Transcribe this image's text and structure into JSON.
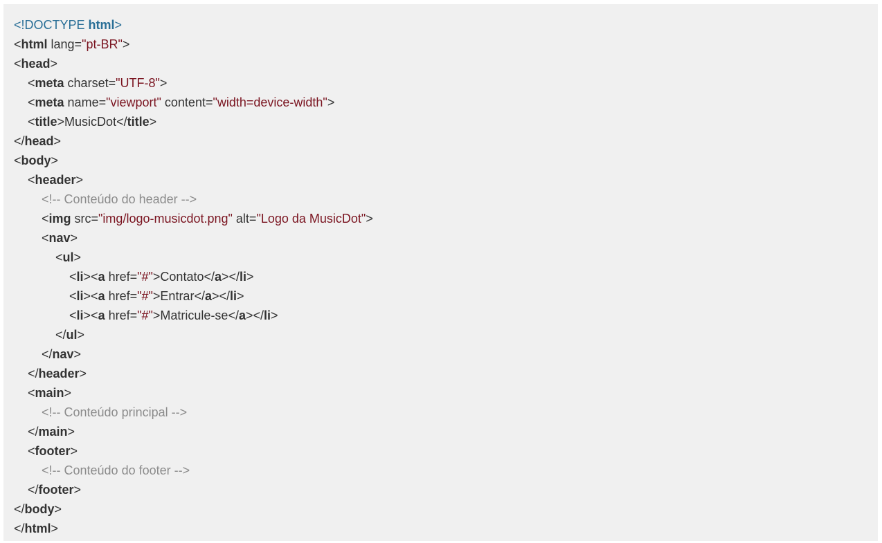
{
  "code": {
    "indent_unit": 20,
    "lines": [
      {
        "indent": 0,
        "tokens": [
          {
            "t": "doctype",
            "v": "<!DOCTYPE "
          },
          {
            "t": "doctype-kw",
            "v": "html"
          },
          {
            "t": "doctype",
            "v": ">"
          }
        ]
      },
      {
        "indent": 0,
        "tokens": [
          {
            "t": "punct",
            "v": "<"
          },
          {
            "t": "tag",
            "v": "html"
          },
          {
            "t": "attr",
            "v": " lang="
          },
          {
            "t": "val",
            "v": "\"pt-BR\""
          },
          {
            "t": "punct",
            "v": ">"
          }
        ]
      },
      {
        "indent": 0,
        "tokens": [
          {
            "t": "punct",
            "v": "<"
          },
          {
            "t": "tag",
            "v": "head"
          },
          {
            "t": "punct",
            "v": ">"
          }
        ]
      },
      {
        "indent": 1,
        "tokens": [
          {
            "t": "punct",
            "v": "<"
          },
          {
            "t": "tag",
            "v": "meta"
          },
          {
            "t": "attr",
            "v": " charset="
          },
          {
            "t": "val",
            "v": "\"UTF-8\""
          },
          {
            "t": "punct",
            "v": ">"
          }
        ]
      },
      {
        "indent": 1,
        "tokens": [
          {
            "t": "punct",
            "v": "<"
          },
          {
            "t": "tag",
            "v": "meta"
          },
          {
            "t": "attr",
            "v": " name="
          },
          {
            "t": "val",
            "v": "\"viewport\""
          },
          {
            "t": "attr",
            "v": " content="
          },
          {
            "t": "val",
            "v": "\"width=device-width\""
          },
          {
            "t": "punct",
            "v": ">"
          }
        ]
      },
      {
        "indent": 1,
        "tokens": [
          {
            "t": "punct",
            "v": "<"
          },
          {
            "t": "tag",
            "v": "title"
          },
          {
            "t": "punct",
            "v": ">"
          },
          {
            "t": "text",
            "v": "MusicDot"
          },
          {
            "t": "punct",
            "v": "</"
          },
          {
            "t": "tag",
            "v": "title"
          },
          {
            "t": "punct",
            "v": ">"
          }
        ]
      },
      {
        "indent": 0,
        "tokens": [
          {
            "t": "punct",
            "v": "</"
          },
          {
            "t": "tag",
            "v": "head"
          },
          {
            "t": "punct",
            "v": ">"
          }
        ]
      },
      {
        "indent": 0,
        "tokens": [
          {
            "t": "punct",
            "v": "<"
          },
          {
            "t": "tag",
            "v": "body"
          },
          {
            "t": "punct",
            "v": ">"
          }
        ]
      },
      {
        "indent": 1,
        "tokens": [
          {
            "t": "punct",
            "v": "<"
          },
          {
            "t": "tag",
            "v": "header"
          },
          {
            "t": "punct",
            "v": ">"
          }
        ]
      },
      {
        "indent": 2,
        "tokens": [
          {
            "t": "comment",
            "v": "<!-- Conteúdo do header -->"
          }
        ]
      },
      {
        "indent": 2,
        "tokens": [
          {
            "t": "punct",
            "v": "<"
          },
          {
            "t": "tag",
            "v": "img"
          },
          {
            "t": "attr",
            "v": " src="
          },
          {
            "t": "val",
            "v": "\"img/logo-musicdot.png\""
          },
          {
            "t": "attr",
            "v": " alt="
          },
          {
            "t": "val",
            "v": "\"Logo da MusicDot\""
          },
          {
            "t": "punct",
            "v": ">"
          }
        ]
      },
      {
        "indent": 2,
        "tokens": [
          {
            "t": "punct",
            "v": "<"
          },
          {
            "t": "tag",
            "v": "nav"
          },
          {
            "t": "punct",
            "v": ">"
          }
        ]
      },
      {
        "indent": 3,
        "tokens": [
          {
            "t": "punct",
            "v": "<"
          },
          {
            "t": "tag",
            "v": "ul"
          },
          {
            "t": "punct",
            "v": ">"
          }
        ]
      },
      {
        "indent": 4,
        "tokens": [
          {
            "t": "punct",
            "v": "<"
          },
          {
            "t": "tag",
            "v": "li"
          },
          {
            "t": "punct",
            "v": "><"
          },
          {
            "t": "tag",
            "v": "a"
          },
          {
            "t": "attr",
            "v": " href="
          },
          {
            "t": "val",
            "v": "\"#\""
          },
          {
            "t": "punct",
            "v": ">"
          },
          {
            "t": "text",
            "v": "Contato"
          },
          {
            "t": "punct",
            "v": "</"
          },
          {
            "t": "tag",
            "v": "a"
          },
          {
            "t": "punct",
            "v": "></"
          },
          {
            "t": "tag",
            "v": "li"
          },
          {
            "t": "punct",
            "v": ">"
          }
        ]
      },
      {
        "indent": 4,
        "tokens": [
          {
            "t": "punct",
            "v": "<"
          },
          {
            "t": "tag",
            "v": "li"
          },
          {
            "t": "punct",
            "v": "><"
          },
          {
            "t": "tag",
            "v": "a"
          },
          {
            "t": "attr",
            "v": " href="
          },
          {
            "t": "val",
            "v": "\"#\""
          },
          {
            "t": "punct",
            "v": ">"
          },
          {
            "t": "text",
            "v": "Entrar"
          },
          {
            "t": "punct",
            "v": "</"
          },
          {
            "t": "tag",
            "v": "a"
          },
          {
            "t": "punct",
            "v": "></"
          },
          {
            "t": "tag",
            "v": "li"
          },
          {
            "t": "punct",
            "v": ">"
          }
        ]
      },
      {
        "indent": 4,
        "tokens": [
          {
            "t": "punct",
            "v": "<"
          },
          {
            "t": "tag",
            "v": "li"
          },
          {
            "t": "punct",
            "v": "><"
          },
          {
            "t": "tag",
            "v": "a"
          },
          {
            "t": "attr",
            "v": " href="
          },
          {
            "t": "val",
            "v": "\"#\""
          },
          {
            "t": "punct",
            "v": ">"
          },
          {
            "t": "text",
            "v": "Matricule-se"
          },
          {
            "t": "punct",
            "v": "</"
          },
          {
            "t": "tag",
            "v": "a"
          },
          {
            "t": "punct",
            "v": "></"
          },
          {
            "t": "tag",
            "v": "li"
          },
          {
            "t": "punct",
            "v": ">"
          }
        ]
      },
      {
        "indent": 3,
        "tokens": [
          {
            "t": "punct",
            "v": "</"
          },
          {
            "t": "tag",
            "v": "ul"
          },
          {
            "t": "punct",
            "v": ">"
          }
        ]
      },
      {
        "indent": 2,
        "tokens": [
          {
            "t": "punct",
            "v": "</"
          },
          {
            "t": "tag",
            "v": "nav"
          },
          {
            "t": "punct",
            "v": ">"
          }
        ]
      },
      {
        "indent": 1,
        "tokens": [
          {
            "t": "punct",
            "v": "</"
          },
          {
            "t": "tag",
            "v": "header"
          },
          {
            "t": "punct",
            "v": ">"
          }
        ]
      },
      {
        "indent": 1,
        "tokens": [
          {
            "t": "punct",
            "v": "<"
          },
          {
            "t": "tag",
            "v": "main"
          },
          {
            "t": "punct",
            "v": ">"
          }
        ]
      },
      {
        "indent": 2,
        "tokens": [
          {
            "t": "comment",
            "v": "<!-- Conteúdo principal -->"
          }
        ]
      },
      {
        "indent": 1,
        "tokens": [
          {
            "t": "punct",
            "v": "</"
          },
          {
            "t": "tag",
            "v": "main"
          },
          {
            "t": "punct",
            "v": ">"
          }
        ]
      },
      {
        "indent": 1,
        "tokens": [
          {
            "t": "punct",
            "v": "<"
          },
          {
            "t": "tag",
            "v": "footer"
          },
          {
            "t": "punct",
            "v": ">"
          }
        ]
      },
      {
        "indent": 2,
        "tokens": [
          {
            "t": "comment",
            "v": "<!-- Conteúdo do footer -->"
          }
        ]
      },
      {
        "indent": 1,
        "tokens": [
          {
            "t": "punct",
            "v": "</"
          },
          {
            "t": "tag",
            "v": "footer"
          },
          {
            "t": "punct",
            "v": ">"
          }
        ]
      },
      {
        "indent": 0,
        "tokens": [
          {
            "t": "punct",
            "v": "</"
          },
          {
            "t": "tag",
            "v": "body"
          },
          {
            "t": "punct",
            "v": ">"
          }
        ]
      },
      {
        "indent": 0,
        "tokens": [
          {
            "t": "punct",
            "v": "</"
          },
          {
            "t": "tag",
            "v": "html"
          },
          {
            "t": "punct",
            "v": ">"
          }
        ]
      }
    ]
  }
}
